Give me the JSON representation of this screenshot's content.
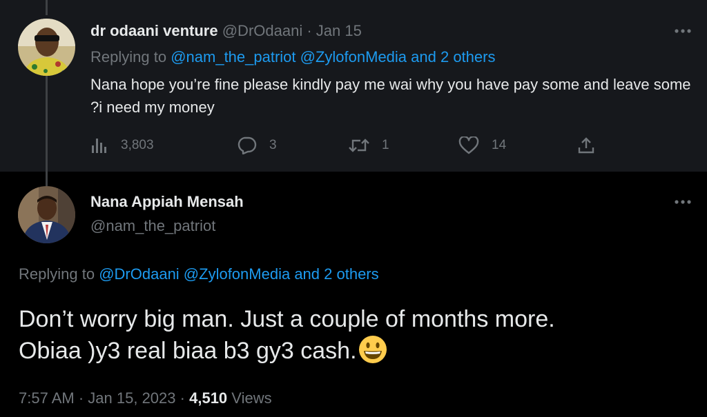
{
  "reply": {
    "display_name": "dr odaani venture",
    "handle": "@DrOdaani",
    "separator": "·",
    "date": "Jan 15",
    "replying_prefix": "Replying to",
    "replying_mentions": "@nam_the_patriot @ZylofonMedia and 2 others",
    "text": "Nana hope you’re fine please kindly pay me wai why you have pay some and leave some ?i need my money",
    "actions": {
      "views": "3,803",
      "replies": "3",
      "retweets": "1",
      "likes": "14"
    },
    "avatar_icon": "user-avatar-icon"
  },
  "main": {
    "display_name": "Nana Appiah Mensah",
    "handle": "@nam_the_patriot",
    "replying_prefix": "Replying to",
    "replying_mentions": "@DrOdaani @ZylofonMedia and 2 others",
    "text_line_1": "Don’t worry big man. Just a couple of months more.",
    "text_line_2": "Obiaa )y3 real biaa b3 gy3 cash.",
    "emoji": "grinning-face-emoji",
    "time": "7:57 AM",
    "separator": "·",
    "date": "Jan 15, 2023",
    "views_count": "4,510",
    "views_label": "Views",
    "avatar_icon": "user-avatar-icon"
  },
  "colors": {
    "background": "#000000",
    "reply_background": "#16181c",
    "text": "#e7e9ea",
    "muted": "#71767b",
    "link": "#1d9bf0",
    "thread_line": "#3e4144"
  }
}
